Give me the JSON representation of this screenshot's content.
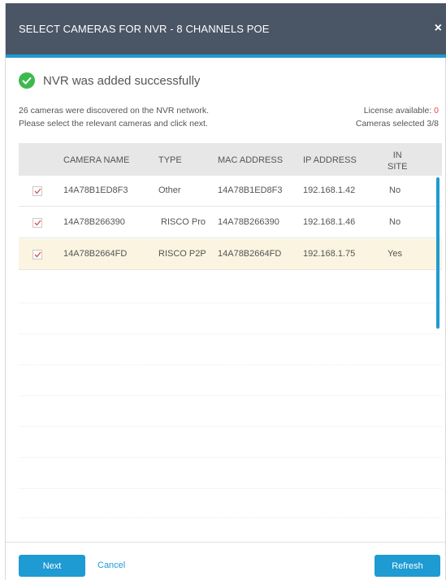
{
  "dialog": {
    "title": "SELECT CAMERAS FOR NVR - 8 CHANNELS POE",
    "close_label": "×"
  },
  "status": {
    "message": "NVR was added successfully"
  },
  "info": {
    "line1": "26 cameras were discovered on the NVR network.",
    "line2": "Please select the relevant cameras and click next.",
    "license_label": "License available: ",
    "license_value": "0",
    "selected_label": "Cameras selected 3/8"
  },
  "table": {
    "headers": {
      "camera_name": "CAMERA NAME",
      "type": "TYPE",
      "mac": "MAC ADDRESS",
      "ip": "IP ADDRESS",
      "in_site_1": "IN",
      "in_site_2": "SITE"
    },
    "rows": [
      {
        "camera_name": "14A78B1ED8F3",
        "type": "Other",
        "mac": "14A78B1ED8F3",
        "ip": "192.168.1.42",
        "in_site": "No",
        "checked": true
      },
      {
        "camera_name": "14A78B266390",
        "type": "RISCO Pro",
        "mac": "14A78B266390",
        "ip": "192.168.1.46",
        "in_site": "No",
        "checked": true
      },
      {
        "camera_name": "14A78B2664FD",
        "type": "RISCO P2P",
        "mac": "14A78B2664FD",
        "ip": "192.168.1.75",
        "in_site": "Yes",
        "checked": true
      }
    ]
  },
  "footer": {
    "next_label": "Next",
    "cancel_label": "Cancel",
    "refresh_label": "Refresh"
  },
  "colors": {
    "header_bg": "#4a5566",
    "accent": "#1e9bd2",
    "success": "#3dba4e",
    "highlight_row": "#fbf4e0",
    "warning_red": "#e24b4b"
  }
}
